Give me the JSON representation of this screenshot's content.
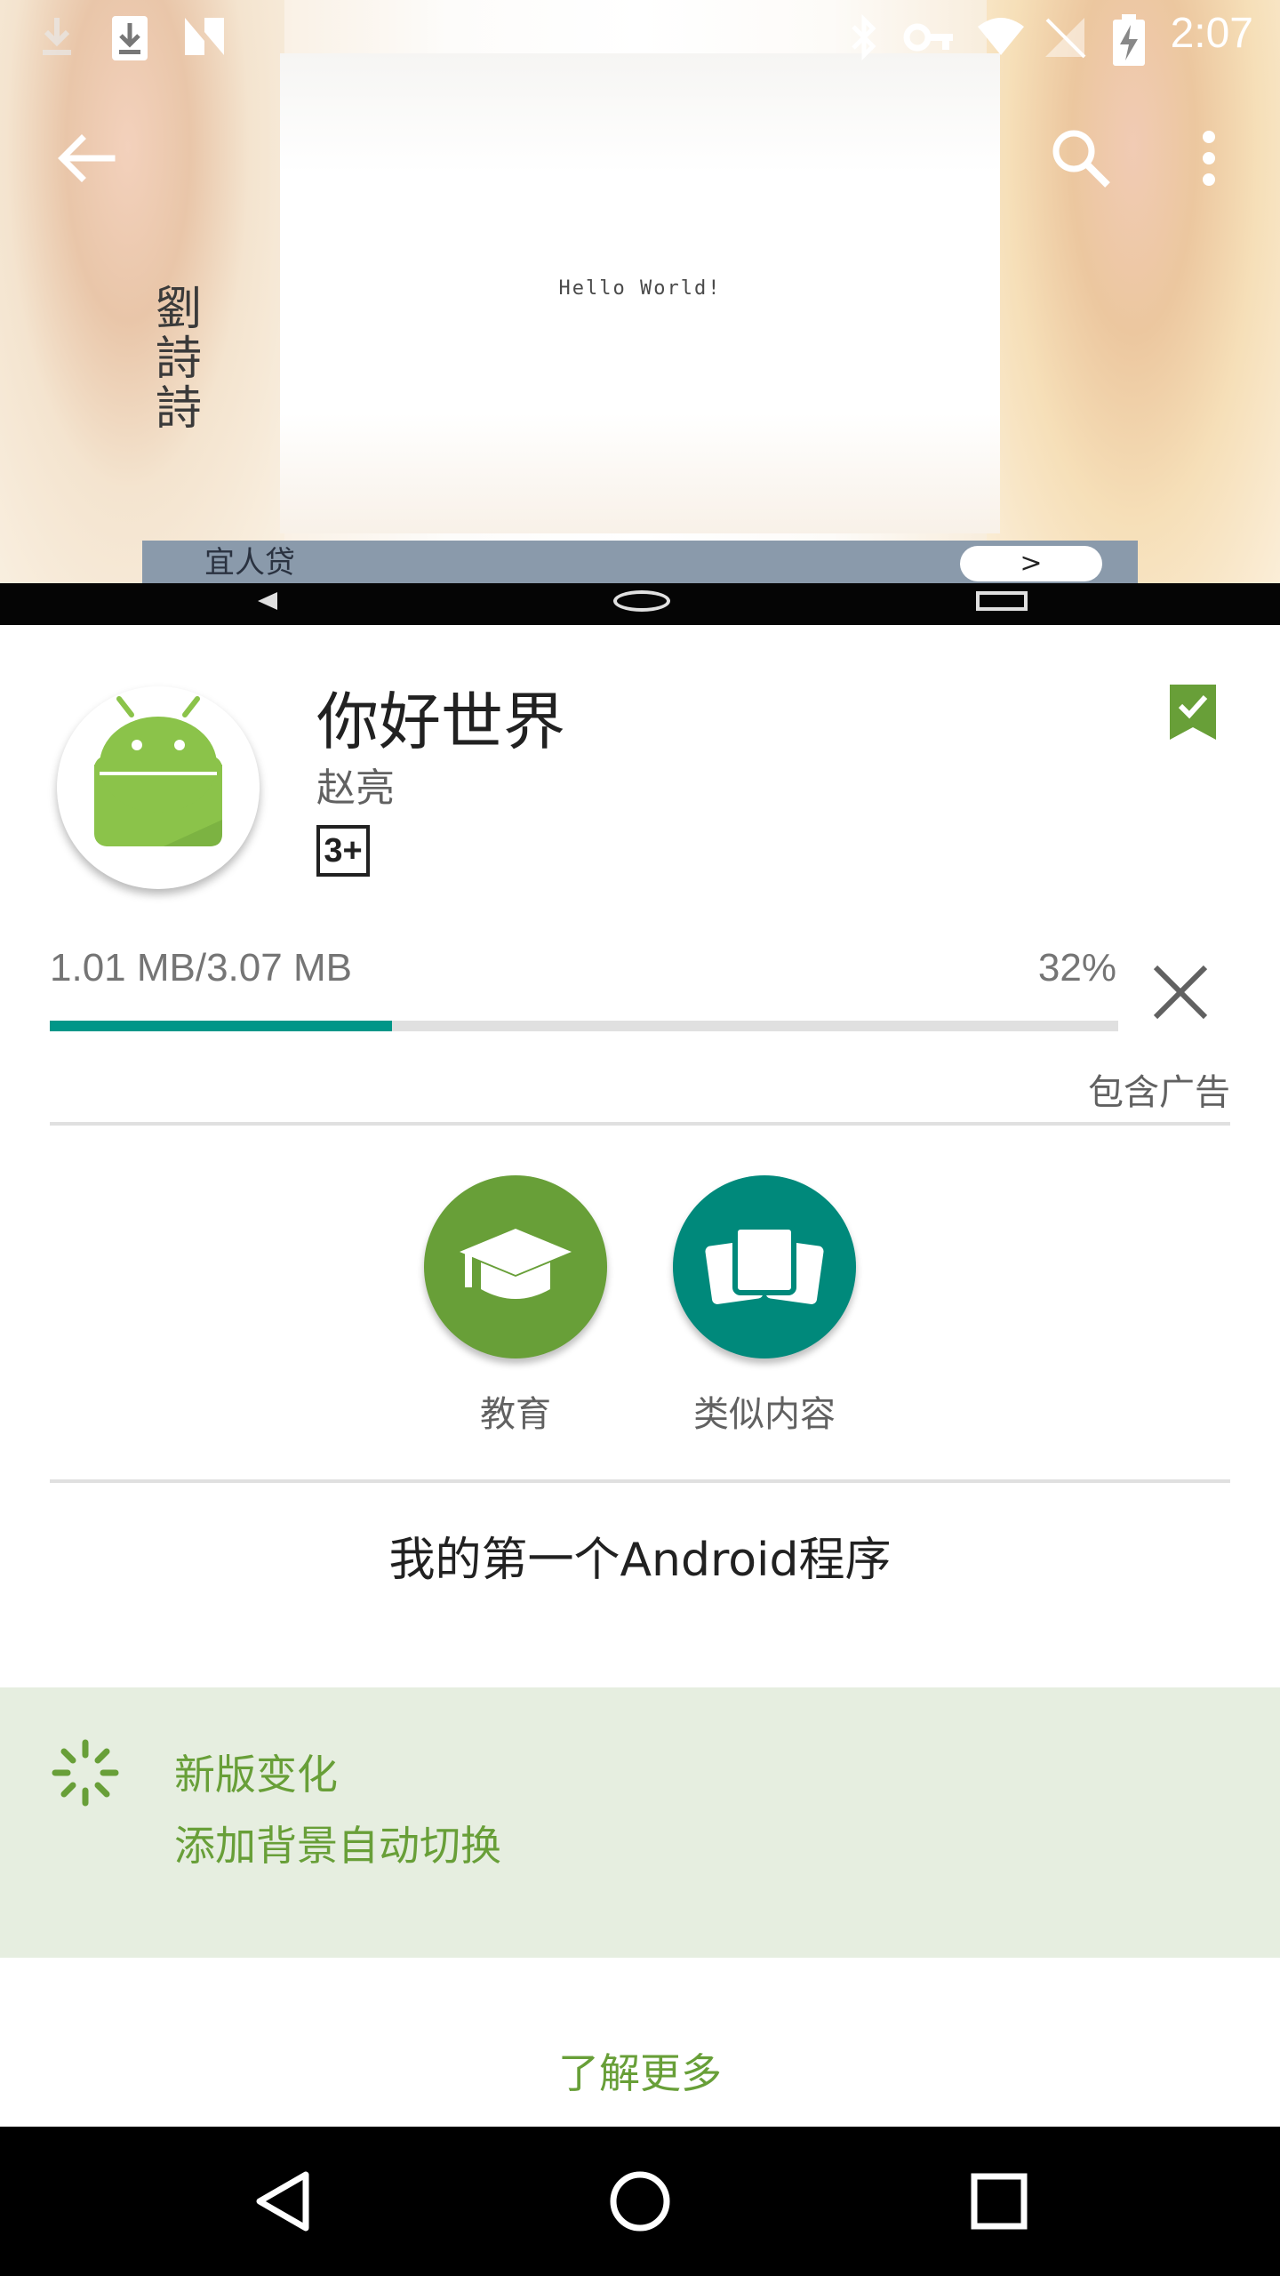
{
  "status_bar": {
    "time": "2:07",
    "icons": [
      "download-icon",
      "download-box-icon",
      "n-logo-icon",
      "bluetooth-icon",
      "vpn-key-icon",
      "wifi-icon",
      "no-signal-icon",
      "battery-charging-icon"
    ]
  },
  "hero": {
    "center_text": "Hello World!",
    "calligraphy": "劉詩詩",
    "ad_text": "宜人贷",
    "ad_go": ">"
  },
  "toolbar": {
    "back_icon": "back-arrow-icon",
    "search_icon": "search-icon",
    "more_icon": "more-vert-icon"
  },
  "app": {
    "title": "你好世界",
    "developer": "赵亮",
    "rating": "3+",
    "icon": "android-icon",
    "wishlist_icon": "wishlist-added-icon"
  },
  "download": {
    "size_text": "1.01 MB/3.07 MB",
    "percent_text": "32%",
    "progress": 0.32,
    "cancel_icon": "close-icon",
    "contains_ads": "包含广告"
  },
  "badges": [
    {
      "label": "教育",
      "icon": "graduation-cap-icon",
      "color": "#689f38"
    },
    {
      "label": "类似内容",
      "icon": "similar-cards-icon",
      "color": "#00897b"
    }
  ],
  "description": "我的第一个Android程序",
  "whats_new": {
    "title": "新版变化",
    "text": "添加背景自动切换",
    "icon": "loading-spinner-icon",
    "color": "#689f38",
    "background": "#e6eee0"
  },
  "read_more": "了解更多",
  "colors": {
    "progress": "#009688",
    "accent_green": "#689f38",
    "teal": "#00897b"
  }
}
